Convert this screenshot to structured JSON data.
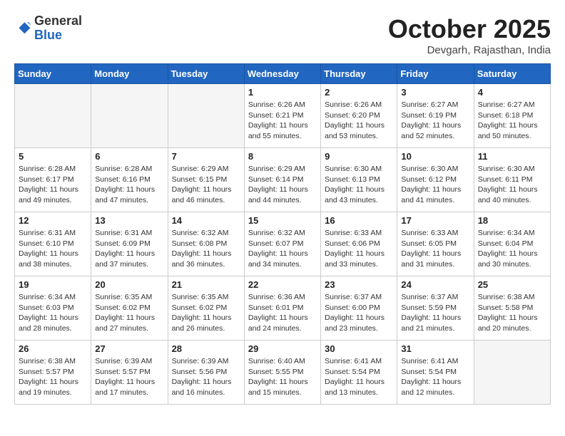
{
  "header": {
    "logo_line1": "General",
    "logo_line2": "Blue",
    "month": "October 2025",
    "location": "Devgarh, Rajasthan, India"
  },
  "weekdays": [
    "Sunday",
    "Monday",
    "Tuesday",
    "Wednesday",
    "Thursday",
    "Friday",
    "Saturday"
  ],
  "weeks": [
    [
      {
        "day": "",
        "info": ""
      },
      {
        "day": "",
        "info": ""
      },
      {
        "day": "",
        "info": ""
      },
      {
        "day": "1",
        "info": "Sunrise: 6:26 AM\nSunset: 6:21 PM\nDaylight: 11 hours\nand 55 minutes."
      },
      {
        "day": "2",
        "info": "Sunrise: 6:26 AM\nSunset: 6:20 PM\nDaylight: 11 hours\nand 53 minutes."
      },
      {
        "day": "3",
        "info": "Sunrise: 6:27 AM\nSunset: 6:19 PM\nDaylight: 11 hours\nand 52 minutes."
      },
      {
        "day": "4",
        "info": "Sunrise: 6:27 AM\nSunset: 6:18 PM\nDaylight: 11 hours\nand 50 minutes."
      }
    ],
    [
      {
        "day": "5",
        "info": "Sunrise: 6:28 AM\nSunset: 6:17 PM\nDaylight: 11 hours\nand 49 minutes."
      },
      {
        "day": "6",
        "info": "Sunrise: 6:28 AM\nSunset: 6:16 PM\nDaylight: 11 hours\nand 47 minutes."
      },
      {
        "day": "7",
        "info": "Sunrise: 6:29 AM\nSunset: 6:15 PM\nDaylight: 11 hours\nand 46 minutes."
      },
      {
        "day": "8",
        "info": "Sunrise: 6:29 AM\nSunset: 6:14 PM\nDaylight: 11 hours\nand 44 minutes."
      },
      {
        "day": "9",
        "info": "Sunrise: 6:30 AM\nSunset: 6:13 PM\nDaylight: 11 hours\nand 43 minutes."
      },
      {
        "day": "10",
        "info": "Sunrise: 6:30 AM\nSunset: 6:12 PM\nDaylight: 11 hours\nand 41 minutes."
      },
      {
        "day": "11",
        "info": "Sunrise: 6:30 AM\nSunset: 6:11 PM\nDaylight: 11 hours\nand 40 minutes."
      }
    ],
    [
      {
        "day": "12",
        "info": "Sunrise: 6:31 AM\nSunset: 6:10 PM\nDaylight: 11 hours\nand 38 minutes."
      },
      {
        "day": "13",
        "info": "Sunrise: 6:31 AM\nSunset: 6:09 PM\nDaylight: 11 hours\nand 37 minutes."
      },
      {
        "day": "14",
        "info": "Sunrise: 6:32 AM\nSunset: 6:08 PM\nDaylight: 11 hours\nand 36 minutes."
      },
      {
        "day": "15",
        "info": "Sunrise: 6:32 AM\nSunset: 6:07 PM\nDaylight: 11 hours\nand 34 minutes."
      },
      {
        "day": "16",
        "info": "Sunrise: 6:33 AM\nSunset: 6:06 PM\nDaylight: 11 hours\nand 33 minutes."
      },
      {
        "day": "17",
        "info": "Sunrise: 6:33 AM\nSunset: 6:05 PM\nDaylight: 11 hours\nand 31 minutes."
      },
      {
        "day": "18",
        "info": "Sunrise: 6:34 AM\nSunset: 6:04 PM\nDaylight: 11 hours\nand 30 minutes."
      }
    ],
    [
      {
        "day": "19",
        "info": "Sunrise: 6:34 AM\nSunset: 6:03 PM\nDaylight: 11 hours\nand 28 minutes."
      },
      {
        "day": "20",
        "info": "Sunrise: 6:35 AM\nSunset: 6:02 PM\nDaylight: 11 hours\nand 27 minutes."
      },
      {
        "day": "21",
        "info": "Sunrise: 6:35 AM\nSunset: 6:02 PM\nDaylight: 11 hours\nand 26 minutes."
      },
      {
        "day": "22",
        "info": "Sunrise: 6:36 AM\nSunset: 6:01 PM\nDaylight: 11 hours\nand 24 minutes."
      },
      {
        "day": "23",
        "info": "Sunrise: 6:37 AM\nSunset: 6:00 PM\nDaylight: 11 hours\nand 23 minutes."
      },
      {
        "day": "24",
        "info": "Sunrise: 6:37 AM\nSunset: 5:59 PM\nDaylight: 11 hours\nand 21 minutes."
      },
      {
        "day": "25",
        "info": "Sunrise: 6:38 AM\nSunset: 5:58 PM\nDaylight: 11 hours\nand 20 minutes."
      }
    ],
    [
      {
        "day": "26",
        "info": "Sunrise: 6:38 AM\nSunset: 5:57 PM\nDaylight: 11 hours\nand 19 minutes."
      },
      {
        "day": "27",
        "info": "Sunrise: 6:39 AM\nSunset: 5:57 PM\nDaylight: 11 hours\nand 17 minutes."
      },
      {
        "day": "28",
        "info": "Sunrise: 6:39 AM\nSunset: 5:56 PM\nDaylight: 11 hours\nand 16 minutes."
      },
      {
        "day": "29",
        "info": "Sunrise: 6:40 AM\nSunset: 5:55 PM\nDaylight: 11 hours\nand 15 minutes."
      },
      {
        "day": "30",
        "info": "Sunrise: 6:41 AM\nSunset: 5:54 PM\nDaylight: 11 hours\nand 13 minutes."
      },
      {
        "day": "31",
        "info": "Sunrise: 6:41 AM\nSunset: 5:54 PM\nDaylight: 11 hours\nand 12 minutes."
      },
      {
        "day": "",
        "info": ""
      }
    ]
  ]
}
